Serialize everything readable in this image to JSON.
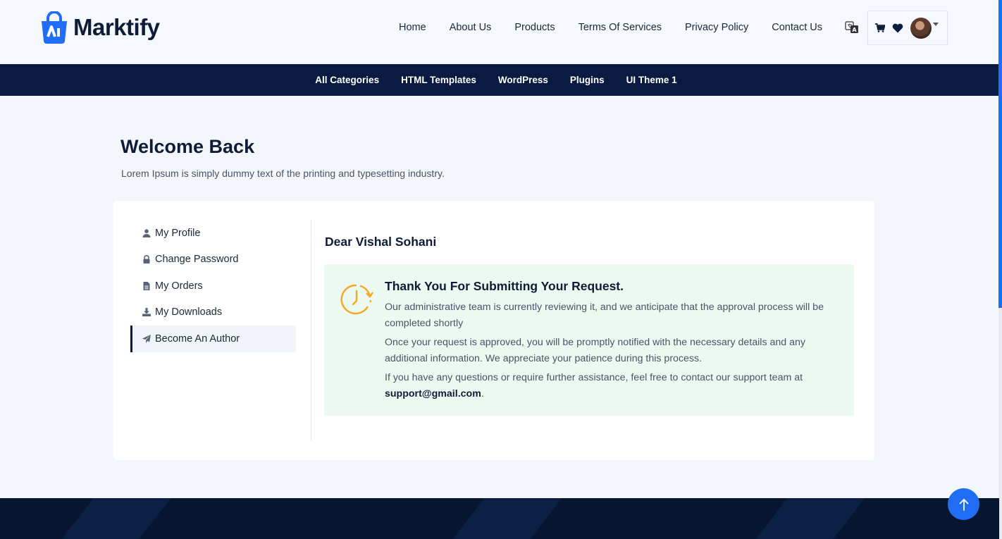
{
  "brand": {
    "name": "Marktify",
    "accent": "#1f6ef5",
    "navy": "#0a1a40"
  },
  "nav": [
    {
      "label": "Home"
    },
    {
      "label": "About Us"
    },
    {
      "label": "Products"
    },
    {
      "label": "Terms Of Services"
    },
    {
      "label": "Privacy Policy"
    },
    {
      "label": "Contact Us"
    }
  ],
  "header_icons": [
    "translate-icon",
    "cart-icon",
    "heart-icon",
    "avatar",
    "chevron-down-icon"
  ],
  "categories": [
    {
      "label": "All Categories"
    },
    {
      "label": "HTML Templates"
    },
    {
      "label": "WordPress"
    },
    {
      "label": "Plugins"
    },
    {
      "label": "UI Theme 1"
    }
  ],
  "welcome": {
    "title": "Welcome Back",
    "subtitle": "Lorem Ipsum is simply dummy text of the printing and typesetting industry."
  },
  "sidebar": {
    "items": [
      {
        "label": "My Profile",
        "icon": "user-icon"
      },
      {
        "label": "Change Password",
        "icon": "lock-icon"
      },
      {
        "label": "My Orders",
        "icon": "file-icon"
      },
      {
        "label": "My Downloads",
        "icon": "download-icon"
      },
      {
        "label": "Become An Author",
        "icon": "paper-plane-icon",
        "active": true
      }
    ]
  },
  "main": {
    "greeting": "Dear Vishal Sohani",
    "notice": {
      "title": "Thank You For Submitting Your Request.",
      "p1": "Our administrative team is currently reviewing it, and we anticipate that the approval process will be completed shortly",
      "p2": "Once your request is approved, you will be promptly notified with the necessary details and any additional information. We appreciate your patience during this process.",
      "p3_prefix": "If you have any questions or require further assistance, feel free to contact our support team at",
      "email": "support@gmail.com",
      "p3_suffix": "."
    }
  }
}
